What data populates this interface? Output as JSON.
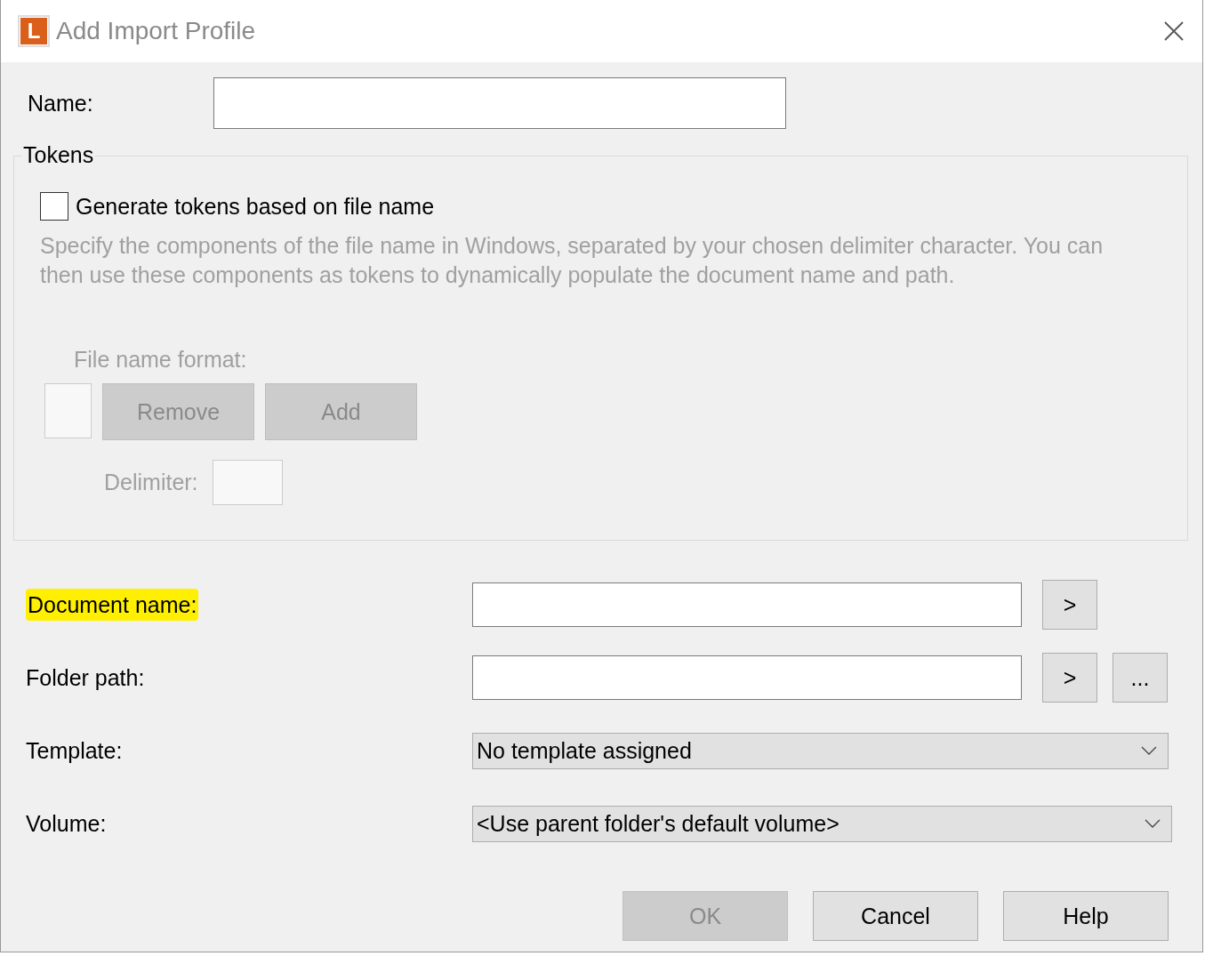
{
  "window": {
    "title": "Add Import Profile",
    "logo_letter": "L"
  },
  "name_field": {
    "label": "Name:"
  },
  "tokens": {
    "title": "Tokens",
    "generate_checkbox": {
      "label": "Generate tokens based on file name",
      "checked": false
    },
    "description": "Specify the components of the file name in Windows, separated by your chosen delimiter character. You can then use these components as tokens to dynamically populate the document name and path.",
    "file_name_format": {
      "label": "File name format:",
      "buttons": [
        "Remove",
        "Add"
      ]
    },
    "delimiter": {
      "label": "Delimiter:"
    }
  },
  "fields": [
    {
      "kind": "text",
      "label": "Document name:",
      "highlighted": true,
      "buttons": [
        ">"
      ]
    },
    {
      "kind": "text",
      "label": "Folder path:",
      "highlighted": false,
      "buttons": [
        ">",
        "..."
      ]
    },
    {
      "kind": "dropdown",
      "label": "Template:",
      "value": "No template assigned"
    },
    {
      "kind": "dropdown",
      "label": "Volume:",
      "value": "<Use parent folder's default volume>"
    }
  ],
  "buttons": [
    {
      "label": "OK",
      "disabled": true
    },
    {
      "label": "Cancel",
      "disabled": false
    },
    {
      "label": "Help",
      "disabled": false
    }
  ]
}
